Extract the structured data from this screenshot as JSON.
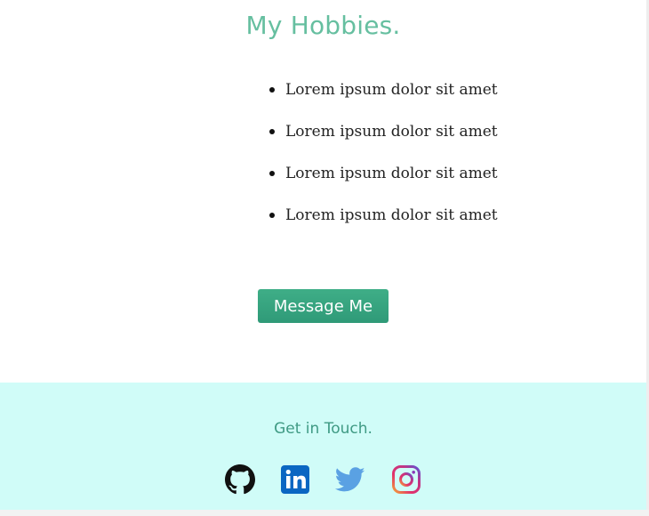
{
  "hobbies": {
    "title": "My Hobbies.",
    "items": [
      "Lorem ipsum dolor sit amet",
      "Lorem ipsum dolor sit amet",
      "Lorem ipsum dolor sit amet",
      "Lorem ipsum dolor sit amet"
    ]
  },
  "message_button": {
    "label": "Message Me"
  },
  "footer": {
    "title": "Get in Touch.",
    "social": [
      {
        "icon": "github-icon",
        "color": "#111111"
      },
      {
        "icon": "linkedin-icon",
        "color": "#0a66c2"
      },
      {
        "icon": "twitter-icon",
        "color": "#5aa1e3"
      },
      {
        "icon": "instagram-icon",
        "color": "#c13584"
      }
    ]
  },
  "colors": {
    "accent": "#66bfa0",
    "button": "#3aa882",
    "footer_bg": "#d0fcf8",
    "footer_text": "#3f9a84"
  }
}
